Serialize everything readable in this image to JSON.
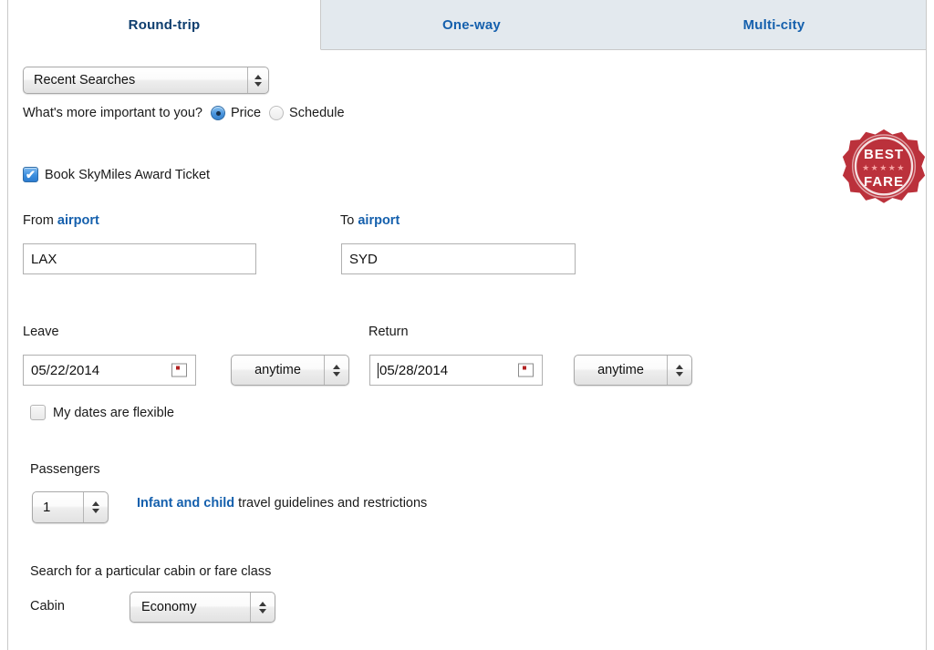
{
  "tabs": [
    {
      "id": "round-trip",
      "label": "Round-trip",
      "active": true
    },
    {
      "id": "one-way",
      "label": "One-way",
      "active": false
    },
    {
      "id": "multi-city",
      "label": "Multi-city",
      "active": false
    }
  ],
  "recent_searches": {
    "value": "Recent Searches"
  },
  "importance": {
    "question": "What's more important to you?",
    "options": [
      {
        "label": "Price",
        "selected": true
      },
      {
        "label": "Schedule",
        "selected": false
      }
    ]
  },
  "skymiles": {
    "label": "Book SkyMiles Award Ticket",
    "checked": true
  },
  "badge": {
    "line1": "BEST",
    "line2": "FARE",
    "stars": "★★★★★",
    "color": "#b51f2a"
  },
  "route": {
    "from_label": "From",
    "from_link": "airport",
    "from_value": "LAX",
    "to_label": "To",
    "to_link": "airport",
    "to_value": "SYD"
  },
  "dates": {
    "leave_label": "Leave",
    "leave_value": "05/22/2014",
    "leave_time": "anytime",
    "return_label": "Return",
    "return_value": "05/28/2014",
    "return_time": "anytime",
    "flexible_label": "My dates are flexible",
    "flexible_checked": false
  },
  "passengers": {
    "label": "Passengers",
    "count": "1",
    "note_link": "Infant and child",
    "note_rest": " travel guidelines and restrictions"
  },
  "cabin": {
    "hint": "Search for a particular cabin or fare class",
    "label": "Cabin",
    "value": "Economy"
  },
  "colors": {
    "link": "#1560ad",
    "active_tab_text": "#0d3d6e",
    "tabstrip_bg": "#e3e9ee",
    "badge_red": "#b51f2a"
  }
}
